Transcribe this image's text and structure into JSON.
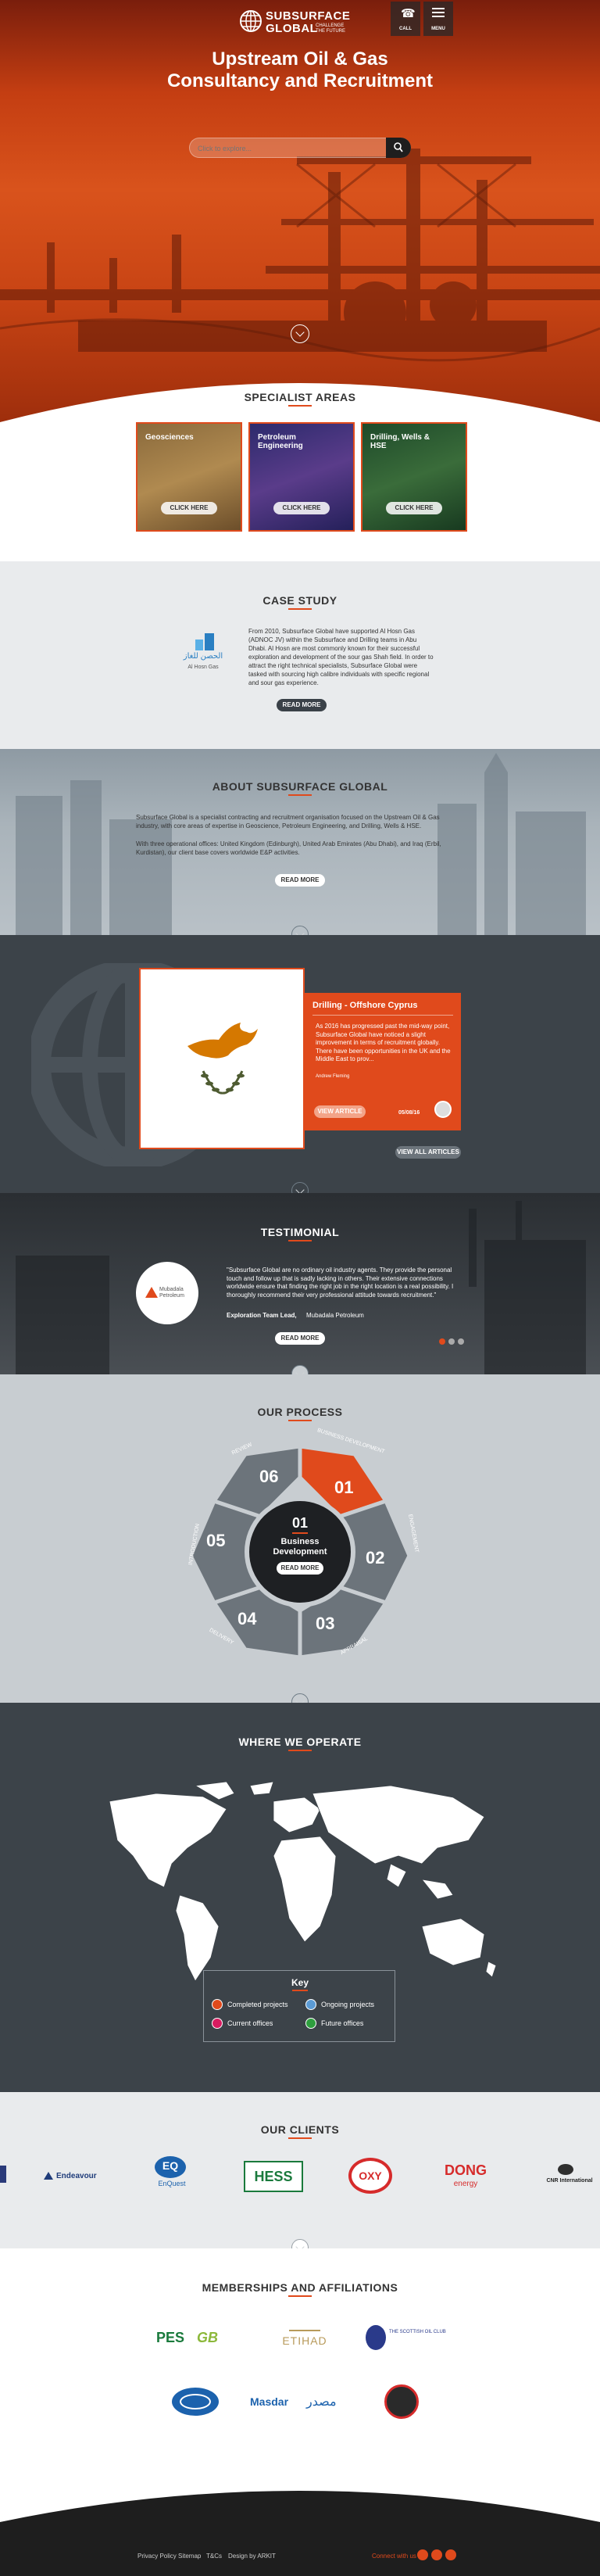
{
  "header": {
    "logo_line1": "SUBSURFACE",
    "logo_line2": "GLOBAL",
    "logo_tag1": "CHALLENGE",
    "logo_tag2": "THE FUTURE",
    "call_label": "CALL",
    "menu_label": "MENU"
  },
  "hero": {
    "title_line1": "Upstream Oil & Gas",
    "title_line2": "Consultancy and Recruitment",
    "search_placeholder": "Click to explore...",
    "accent_color": "#e04a1c"
  },
  "specialist": {
    "heading": "SPECIALIST AREAS",
    "cards": [
      {
        "title": "Geosciences",
        "button": "CLICK HERE"
      },
      {
        "title": "Petroleum Engineering",
        "button": "CLICK HERE"
      },
      {
        "title": "Drilling, Wells & HSE",
        "button": "CLICK HERE"
      }
    ]
  },
  "case_study": {
    "heading": "CASE STUDY",
    "logo_arabic": "الحصن للغاز",
    "logo_english": "Al Hosn Gas",
    "body": "From 2010, Subsurface Global have supported Al Hosn Gas (ADNOC JV) within the Subsurface and Drilling teams in Abu Dhabi. Al Hosn are most commonly known for their successful exploration and development of the sour gas Shah field. In order to attract the right technical specialists, Subsurface Global were tasked with sourcing high calibre individuals with specific regional and sour gas experience.",
    "button": "READ MORE"
  },
  "about": {
    "heading": "ABOUT SUBSURFACE GLOBAL",
    "para1": "Subsurface Global is a specialist contracting and recruitment organisation focused on the Upstream Oil & Gas industry, with core areas of expertise in Geoscience, Petroleum Engineering, and Drilling, Wells & HSE.",
    "para2": "With three operational offices: United Kingdom (Edinburgh), United Arab Emirates (Abu Dhabi), and Iraq (Erbil, Kurdistan), our client base covers worldwide E&P activities.",
    "button": "READ MORE"
  },
  "news": {
    "title": "Drilling - Offshore Cyprus",
    "body": "As 2016 has progressed past the mid-way point, Subsurface Global have noticed a slight improvement in terms of recruitment globally. There have been opportunities in the UK and the Middle East to prov...",
    "author": "Andrew Fleming",
    "date": "05/08/16",
    "view_article": "VIEW ARTICLE",
    "view_all": "VIEW ALL ARTICLES"
  },
  "testimonial": {
    "heading": "TESTIMONIAL",
    "logo_name": "Mubadala Petroleum",
    "quote": "\"Subsurface Global are no ordinary oil industry agents. They provide the personal touch and follow up that is sadly lacking in others. Their extensive connections worldwide ensure that finding the right job in the right location is a real possibility. I thoroughly recommend their very professional attitude towards recruitment.\"",
    "author_role": "Exploration Team Lead,",
    "author_company": "Mubadala Petroleum",
    "button": "READ MORE"
  },
  "process": {
    "heading": "OUR PROCESS",
    "center_num": "01",
    "center_title": "Business Development",
    "center_button": "READ MORE",
    "steps": [
      {
        "num": "01",
        "label": "BUSINESS DEVELOPMENT"
      },
      {
        "num": "02",
        "label": "ENGAGEMENT"
      },
      {
        "num": "03",
        "label": "APPRAISAL"
      },
      {
        "num": "04",
        "label": "DELIVERY"
      },
      {
        "num": "05",
        "label": "INTRODUCTION"
      },
      {
        "num": "06",
        "label": "REVIEW"
      }
    ]
  },
  "operate": {
    "heading": "WHERE WE OPERATE",
    "key_title": "Key",
    "key": [
      {
        "label": "Completed projects",
        "color": "#e04a1c"
      },
      {
        "label": "Ongoing projects",
        "color": "#5b9bd5"
      },
      {
        "label": "Current offices",
        "color": "#d81b60"
      },
      {
        "label": "Future offices",
        "color": "#2e9e3e"
      }
    ]
  },
  "clients": {
    "heading": "OUR CLIENTS",
    "logos": [
      "Endeavour",
      "EQ",
      "EnQuest",
      "HESS",
      "OXY",
      "DONG",
      "energy",
      "CNR International"
    ]
  },
  "memberships": {
    "heading": "MEMBERSHIPS AND AFFILIATIONS",
    "logos": [
      "PES",
      "GB",
      "ETIHAD",
      "THE SCOTTISH OIL CLUB",
      "Masdar",
      "مصدر"
    ]
  },
  "footer": {
    "links": [
      "Privacy Policy",
      "Sitemap",
      "T&Cs",
      "Design by ARKIT"
    ],
    "connect": "Connect with us"
  }
}
